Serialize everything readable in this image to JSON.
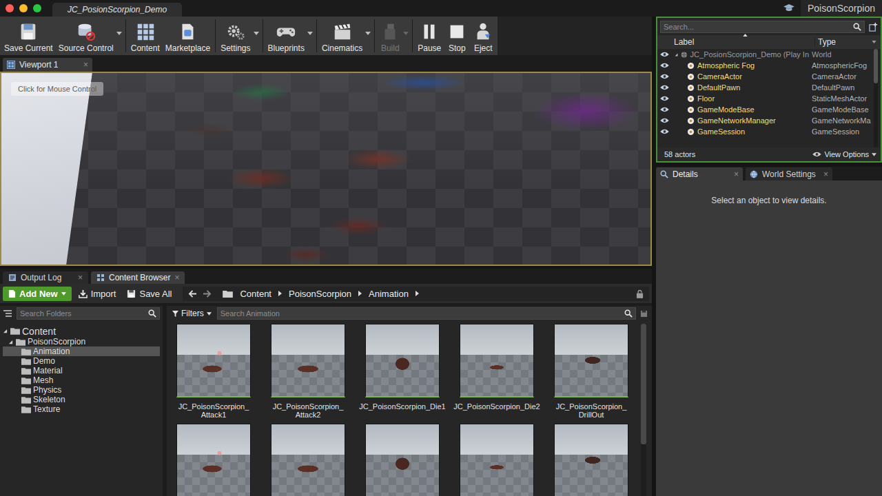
{
  "window": {
    "tab": "JC_PosionScorpion_Demo",
    "project": "PoisonScorpion"
  },
  "toolbar": [
    {
      "label": "Save Current",
      "dropdown": false,
      "disabled": false
    },
    {
      "label": "Source Control",
      "dropdown": true,
      "disabled": false
    },
    {
      "label": "Content",
      "dropdown": false,
      "disabled": false
    },
    {
      "label": "Marketplace",
      "dropdown": false,
      "disabled": false
    },
    {
      "label": "Settings",
      "dropdown": true,
      "disabled": false
    },
    {
      "label": "Blueprints",
      "dropdown": true,
      "disabled": false
    },
    {
      "label": "Cinematics",
      "dropdown": true,
      "disabled": false
    },
    {
      "label": "Build",
      "dropdown": true,
      "disabled": true
    },
    {
      "label": "Pause",
      "dropdown": false,
      "disabled": false
    },
    {
      "label": "Stop",
      "dropdown": false,
      "disabled": false
    },
    {
      "label": "Eject",
      "dropdown": false,
      "disabled": false
    }
  ],
  "viewport": {
    "tab": "Viewport 1",
    "close": "×",
    "hint": "Click for Mouse Control"
  },
  "outliner": {
    "search": "Search...",
    "columns": [
      "Label",
      "Type"
    ],
    "rows": [
      {
        "label": "JC_PosionScorpion_Demo (Play In",
        "type": "World",
        "kind": "world",
        "visible": true
      },
      {
        "label": "Atmospheric Fog",
        "type": "AtmosphericFog",
        "kind": "actor",
        "visible": true
      },
      {
        "label": "CameraActor",
        "type": "CameraActor",
        "kind": "actor",
        "visible": true
      },
      {
        "label": "DefaultPawn",
        "type": "DefaultPawn",
        "kind": "actor",
        "visible": true
      },
      {
        "label": "Floor",
        "type": "StaticMeshActor",
        "kind": "actor",
        "visible": true
      },
      {
        "label": "GameModeBase",
        "type": "GameModeBase",
        "kind": "actor",
        "visible": true
      },
      {
        "label": "GameNetworkManager",
        "type": "GameNetworkMa",
        "kind": "actor",
        "visible": true
      },
      {
        "label": "GameSession",
        "type": "GameSession",
        "kind": "actor",
        "visible": true
      }
    ],
    "count": "58 actors",
    "view_options": "View Options"
  },
  "details": {
    "tabs": [
      {
        "label": "Details",
        "selected": true
      },
      {
        "label": "World Settings",
        "selected": false
      }
    ],
    "close": "×",
    "message": "Select an object to view details."
  },
  "bottom": {
    "tabs": [
      {
        "label": "Output Log",
        "selected": false
      },
      {
        "label": "Content Browser",
        "selected": true
      }
    ],
    "close": "×"
  },
  "content_browser": {
    "add_new": "Add New",
    "import": "Import",
    "save_all": "Save All",
    "breadcrumb": [
      "Content",
      "PoisonScorpion",
      "Animation"
    ]
  },
  "folders": {
    "search": "Search Folders",
    "items": [
      {
        "label": "Content",
        "depth": 0,
        "expanded": true,
        "selected": false
      },
      {
        "label": "PoisonScorpion",
        "depth": 1,
        "expanded": true,
        "selected": false
      },
      {
        "label": "Animation",
        "depth": 2,
        "expanded": false,
        "selected": true
      },
      {
        "label": "Demo",
        "depth": 2,
        "expanded": false,
        "selected": false
      },
      {
        "label": "Material",
        "depth": 2,
        "expanded": false,
        "selected": false
      },
      {
        "label": "Mesh",
        "depth": 2,
        "expanded": false,
        "selected": false
      },
      {
        "label": "Physics",
        "depth": 2,
        "expanded": false,
        "selected": false
      },
      {
        "label": "Skeleton",
        "depth": 2,
        "expanded": false,
        "selected": false
      },
      {
        "label": "Texture",
        "depth": 2,
        "expanded": false,
        "selected": false
      }
    ]
  },
  "assets": {
    "filters": "Filters",
    "search": "Search Animation",
    "items": [
      {
        "name": "JC_PoisonScorpion_Attack1"
      },
      {
        "name": "JC_PoisonScorpion_Attack2"
      },
      {
        "name": "JC_PoisonScorpion_Die1"
      },
      {
        "name": "JC_PoisonScorpion_Die2"
      },
      {
        "name": "JC_PoisonScorpion_DrillOut"
      },
      {
        "name": ""
      },
      {
        "name": ""
      },
      {
        "name": ""
      },
      {
        "name": ""
      },
      {
        "name": ""
      }
    ]
  }
}
